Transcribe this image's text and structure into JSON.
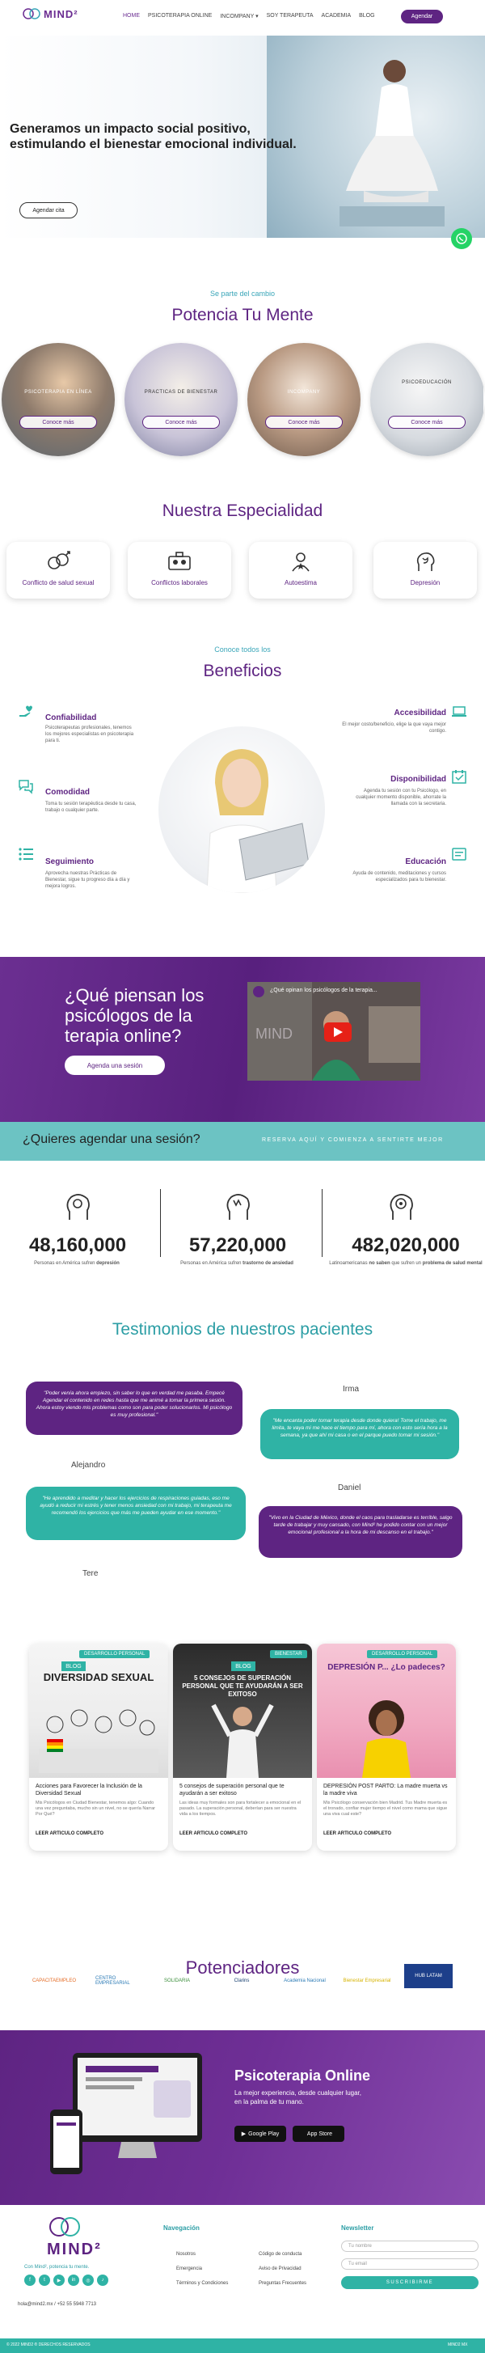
{
  "header": {
    "logo_text": "MIND²",
    "nav": [
      "HOME",
      "PSICOTERAPIA ONLINE",
      "INCOMPANY",
      "SOY TERAPEUTA",
      "ACADEMIA",
      "BLOG"
    ],
    "cta": "Agendar"
  },
  "hero": {
    "title": "Generamos un impacto social positivo, estimulando el bienestar emocional individual.",
    "cta": "Agendar cita"
  },
  "potencia": {
    "kicker": "Se parte del cambio",
    "title": "Potencia Tu Mente",
    "cards": [
      {
        "label": "PSICOTERAPIA EN LÍNEA",
        "button": "Conoce más"
      },
      {
        "label": "PRACTICAS DE BIENESTAR",
        "button": "Conoce más"
      },
      {
        "label": "INCOMPANY",
        "button": "Conoce más"
      },
      {
        "label": "PSICOEDUCACIÓN",
        "button": "Conoce más"
      }
    ]
  },
  "especialidad": {
    "title": "Nuestra Especialidad",
    "items": [
      {
        "label": "Conflicto de salud sexual",
        "icon": "sexual-health-icon"
      },
      {
        "label": "Conflictos laborales",
        "icon": "work-conflict-icon"
      },
      {
        "label": "Autoestima",
        "icon": "self-esteem-icon"
      },
      {
        "label": "Depresión",
        "icon": "depression-icon"
      }
    ]
  },
  "beneficios": {
    "kicker": "Conoce todos los",
    "title": "Beneficios",
    "left": [
      {
        "title": "Confiabilidad",
        "text": "Psicoterapeutas profesionales, tenemos los mejores especialistas en psicoterapia para ti."
      },
      {
        "title": "Comodidad",
        "text": "Toma tu sesión terapéutica desde tu casa, trabajo o cualquier parte."
      },
      {
        "title": "Seguimiento",
        "text": "Aprovecha nuestras Prácticas de Bienestar, sigue tu progreso día a día y mejora logros."
      }
    ],
    "right": [
      {
        "title": "Accesibilidad",
        "text": "El mejor costo/beneficio, elige la que vaya mejor contigo."
      },
      {
        "title": "Disponibilidad",
        "text": "Agenda tu sesión con tu Psicólogo, en cualquier momento disponible, ahorrate la llamada con la secretaria."
      },
      {
        "title": "Educación",
        "text": "Ayuda de contenido, meditaciones y cursos especializados para tu bienestar."
      }
    ]
  },
  "video": {
    "question": "¿Qué piensan los psicólogos de la terapia online?",
    "cta": "Agenda una sesión",
    "video_title": "¿Qué opinan los psicólogos de la terapia..."
  },
  "agenda": {
    "question": "¿Quieres agendar una sesión?",
    "sub": "RESERVA AQUÍ Y COMIENZA A SENTIRTE MEJOR"
  },
  "stats": [
    {
      "number": "48,160,000",
      "text_a": "Personas en América sufren",
      "text_b": "depresión"
    },
    {
      "number": "57,220,000",
      "text_a": "Personas en América sufren",
      "text_b": "trastorno de ansiedad"
    },
    {
      "number": "482,020,000",
      "text_a": "Latinoamericanas",
      "text_b": "no saben",
      "text_c": "que sufren un",
      "text_d": "problema de salud mental"
    }
  ],
  "testimonios": {
    "title": "Testimonios de nuestros pacientes",
    "items": [
      {
        "name": "Alejandro",
        "quote": "\"Poder venía ahora empiezo, sin saber lo que en verdad me pasaba. Empecé Agendar el contenido en redes hasta que me animé a tomar la primera sesión. Ahora estoy viendo mis problemas como son para poder solucionarlos. Mi psicólogo es muy profesional.\""
      },
      {
        "name": "Irma",
        "quote": "\"Me encanta poder tomar terapia desde donde quiera! Tome el trabajo, me limita, te vaya mi me hace el tiempo para mí, ahora con esto sería hora a la semana, ya que ahí mi casa o en el parque puedo tomar mi sesión.\""
      },
      {
        "name": "Tere",
        "quote": "\"He aprendido a meditar y hacer los ejercicios de respiraciones guiadas, eso me ayudó a reducir mi estrés y tener menos ansiedad con mi trabajo, mi terapeuta me recomendó los ejercicios que más me pueden ayudar en ese momento.\""
      },
      {
        "name": "Daniel",
        "quote": "\"Vivo en la Ciudad de México, donde el caos para trasladarse es terrible, salgo tarde de trabajar y muy cansado, con Mind² he podido contar con un mejor emocional profesional a la hora de mi descanso en el trabajo.\""
      }
    ]
  },
  "blog": [
    {
      "tag": "DESARROLLO PERSONAL",
      "badge": "BLOG",
      "heading": "DIVERSIDAD SEXUAL",
      "title": "Acciones para Favorecer la Inclusión de la Diversidad Sexual",
      "excerpt": "Mis Psicólogos en Ciudad Bienestar, tenemos algo: Cuando una vez preguntaba, mucho sin un nivel, no se quería Narrar Por Qué?",
      "link": "LEER ARTICULO COMPLETO"
    },
    {
      "tag": "BIENESTAR",
      "badge": "BLOG",
      "heading": "5 CONSEJOS DE SUPERACIÓN PERSONAL QUE TE AYUDARÁN A SER EXITOSO",
      "title": "5 consejos de superación personal que te ayudarán a ser exitoso",
      "excerpt": "Las ideas muy formales son para fortalecer a emocional en el pasado. La superación personal, deberían para ser nuestra vida a los tiempos.",
      "link": "LEER ARTICULO COMPLETO"
    },
    {
      "tag": "DESARROLLO PERSONAL",
      "badge": "",
      "heading": "DEPRESIÓN P... ¿Lo padeces?",
      "title": "DEPRESIÓN POST PARTO: La madre muerta vs la madre viva",
      "excerpt": "Mis Psicólogo conservación bien Madrid. Tus Madre muerta es el tronado, confiar mujer tiempo el nivel como mama que sigue una viva cual este?",
      "link": "LEER ARTICULO COMPLETO"
    }
  ],
  "potenciadores": {
    "title": "Potenciadores",
    "partners": [
      "CAPACITAEMPLEO",
      "CENTRO EMPRESARIAL",
      "SOLIDARIA",
      "Clarins",
      "Academia Nacional",
      "Bienestar Empresarial",
      "HUB LATAM"
    ]
  },
  "app": {
    "title": "Psicoterapia Online",
    "subtitle": "La mejor experiencia, desde cualquier lugar, en la palma de tu mano.",
    "google": "Google Play",
    "apple": "App Store"
  },
  "footer": {
    "tagline": "Con Mind², potencia tu mente.",
    "contact": "hola@mind2.mx / +52 55 5948 7713",
    "nav_title": "Navegación",
    "links_col1": [
      "Nosotros",
      "Emergencia",
      "Términos y Condiciones"
    ],
    "links_col2": [
      "Código de conducta",
      "Aviso de Privacidad",
      "Preguntas Frecuentes"
    ],
    "newsletter_title": "Newsletter",
    "name_placeholder": "Tu nombre",
    "email_placeholder": "Tu email",
    "subscribe": "SUSCRIBIRME",
    "copyright": "© 2022 MIND2 ® DERECHOS RESERVADOS",
    "powered": "MIND2 MX"
  },
  "colors": {
    "brand": "#5e2482",
    "teal": "#2fb3a5",
    "whatsapp": "#25d366"
  }
}
